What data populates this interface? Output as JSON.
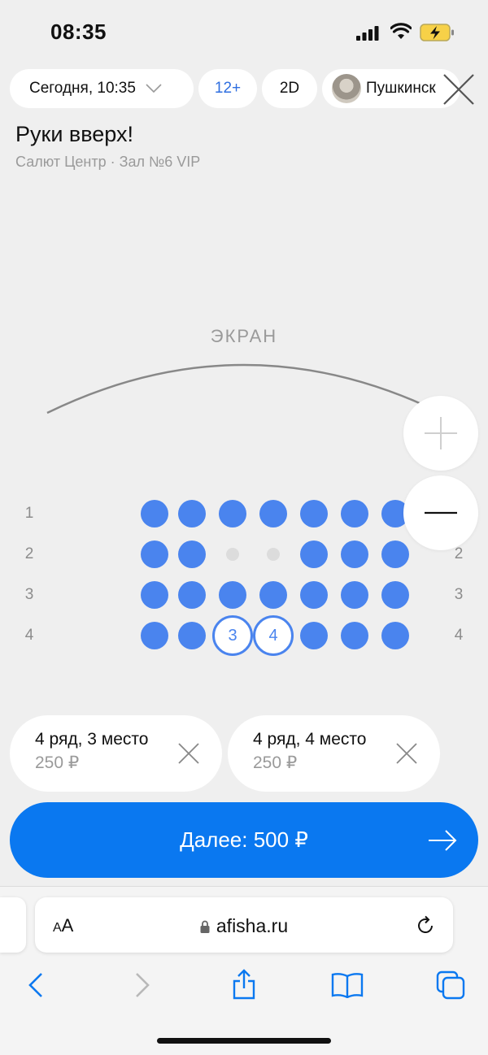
{
  "status_bar": {
    "time": "08:35"
  },
  "filters": {
    "date": "Сегодня, 10:35",
    "age": "12+",
    "format": "2D",
    "pushkin": "Пушкинск"
  },
  "movie": {
    "title": "Руки вверх!",
    "venue": "Салют Центр · Зал №6 VIP"
  },
  "hall": {
    "screen_label": "ЭКРАН",
    "rows": [
      {
        "label": "1",
        "seats": [
          "free",
          "free",
          "free",
          "free",
          "free",
          "free",
          "free"
        ]
      },
      {
        "label": "2",
        "seats": [
          "free",
          "free",
          "taken",
          "taken",
          "free",
          "free",
          "free"
        ]
      },
      {
        "label": "3",
        "seats": [
          "free",
          "free",
          "free",
          "free",
          "free",
          "free",
          "free"
        ]
      },
      {
        "label": "4",
        "seats": [
          "free",
          "free",
          "selected:3",
          "selected:4",
          "free",
          "free",
          "free"
        ]
      }
    ]
  },
  "tickets": [
    {
      "line1": "4 ряд, 3 место",
      "price": "250 ₽"
    },
    {
      "line1": "4 ряд, 4 место",
      "price": "250 ₽"
    }
  ],
  "cta": {
    "label": "Далее: 500 ₽"
  },
  "browser": {
    "text_size": "AA",
    "url": "afisha.ru"
  },
  "colors": {
    "accent": "#0a78f0",
    "seat": "#4a84ee"
  }
}
